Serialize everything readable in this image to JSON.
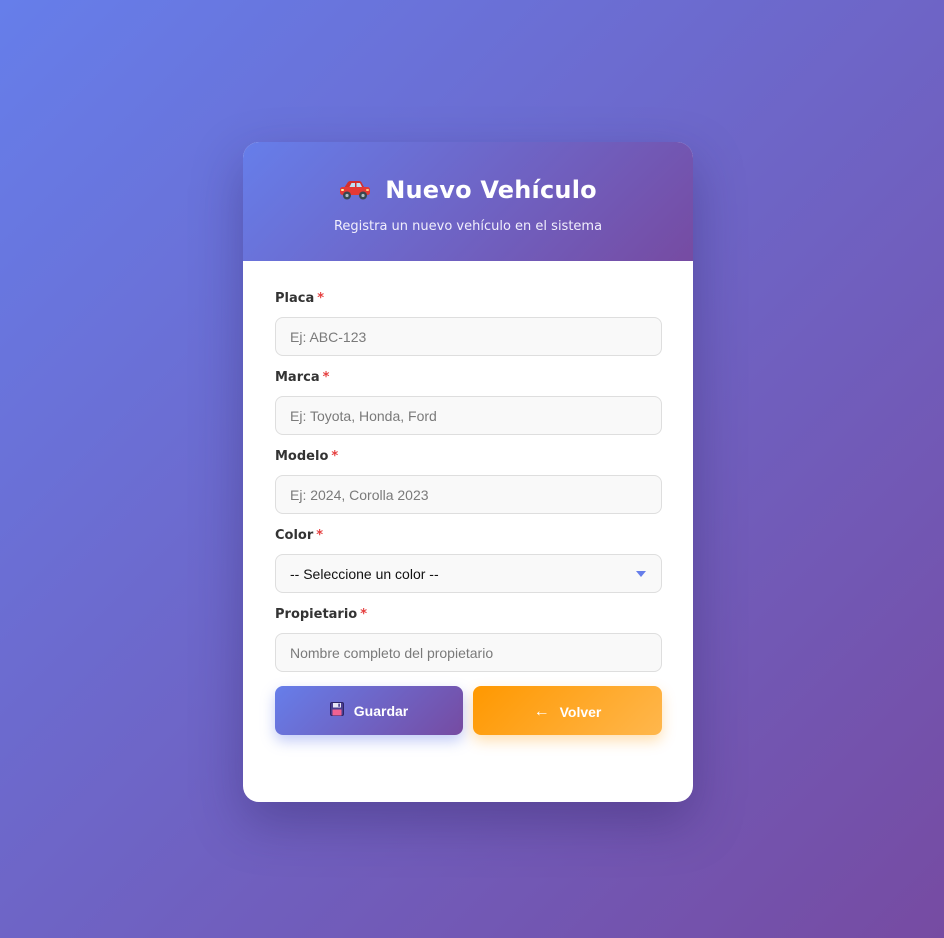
{
  "header": {
    "icon": "car-icon",
    "title": "Nuevo Vehículo",
    "subtitle": "Registra un nuevo vehículo en el sistema"
  },
  "form": {
    "required_marker": "*",
    "placa": {
      "label": "Placa",
      "placeholder": "Ej: ABC-123",
      "value": ""
    },
    "marca": {
      "label": "Marca",
      "placeholder": "Ej: Toyota, Honda, Ford",
      "value": ""
    },
    "modelo": {
      "label": "Modelo",
      "placeholder": "Ej: 2024, Corolla 2023",
      "value": ""
    },
    "color": {
      "label": "Color",
      "selected": "-- Seleccione un color --"
    },
    "propietario": {
      "label": "Propietario",
      "placeholder": "Nombre completo del propietario",
      "value": ""
    }
  },
  "actions": {
    "save": {
      "label": "Guardar",
      "icon": "floppy-disk-icon"
    },
    "back": {
      "label": "Volver",
      "icon": "arrow-left-icon",
      "glyph": "←"
    }
  },
  "colors": {
    "gradient_start": "#667eea",
    "gradient_end": "#764ba2",
    "back_start": "#ff9800",
    "back_end": "#ffb74d",
    "required": "#e53e3e"
  }
}
